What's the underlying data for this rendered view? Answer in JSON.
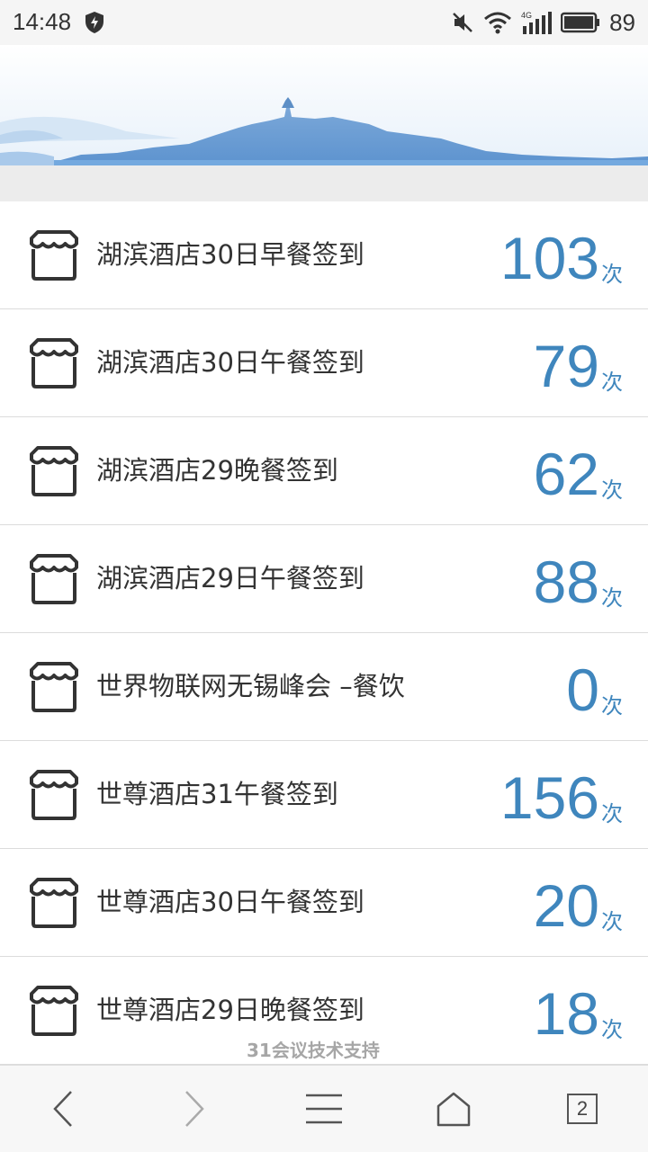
{
  "status": {
    "time": "14:48",
    "battery": "89",
    "network": "4G"
  },
  "list": {
    "unit": "次",
    "items": [
      {
        "label": "湖滨酒店30日早餐签到",
        "count": "103"
      },
      {
        "label": "湖滨酒店30日午餐签到",
        "count": "79"
      },
      {
        "label": "湖滨酒店29晚餐签到",
        "count": "62"
      },
      {
        "label": "湖滨酒店29日午餐签到",
        "count": "88"
      },
      {
        "label": "世界物联网无锡峰会 –餐饮",
        "count": "0"
      },
      {
        "label": "世尊酒店31午餐签到",
        "count": "156"
      },
      {
        "label": "世尊酒店30日午餐签到",
        "count": "20"
      },
      {
        "label": "世尊酒店29日晚餐签到",
        "count": "18"
      }
    ]
  },
  "watermark": "31会议技术支持",
  "browser": {
    "tab_count": "2"
  },
  "colors": {
    "accent": "#3f86bd",
    "text": "#333333",
    "banner": "#6fa6dc"
  }
}
